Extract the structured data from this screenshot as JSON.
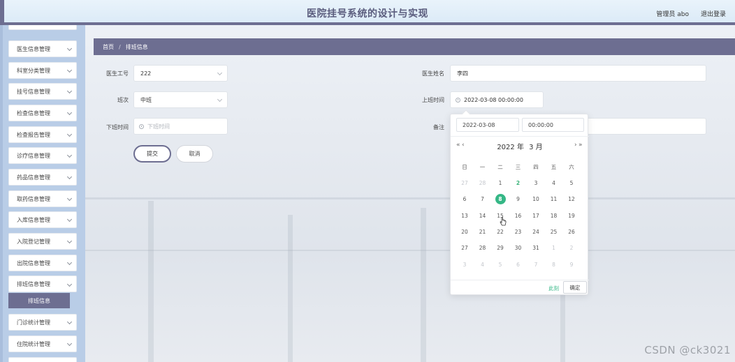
{
  "header": {
    "title": "医院挂号系统的设计与实现",
    "admin_label": "管理员 abo",
    "logout_label": "退出登录"
  },
  "sidebar": {
    "items": [
      {
        "label": "医生信息管理",
        "top": 0
      },
      {
        "label": "科室分类管理"
      },
      {
        "label": "挂号信息管理"
      },
      {
        "label": "检查信息管理"
      },
      {
        "label": "检查报告管理"
      },
      {
        "label": "诊疗信息管理"
      },
      {
        "label": "药品信息管理"
      },
      {
        "label": "取药信息管理"
      },
      {
        "label": "入库信息管理"
      },
      {
        "label": "入院登记管理"
      },
      {
        "label": "出院信息管理"
      },
      {
        "label": "排班信息管理"
      },
      {
        "label": "门诊统计管理"
      },
      {
        "label": "住院统计管理"
      }
    ],
    "active_sub": "排班信息"
  },
  "breadcrumb": {
    "home": "首页",
    "separator": "/",
    "current": "排班信息"
  },
  "form": {
    "doctor_id": {
      "label": "医生工号",
      "value": "222"
    },
    "doctor_name": {
      "label": "医生姓名",
      "value": "李四"
    },
    "shift": {
      "label": "班次",
      "value": "中班"
    },
    "start_time": {
      "label": "上班时间",
      "value": "2022-03-08 00:00:00"
    },
    "end_time": {
      "label": "下班时间",
      "placeholder": "下班时间"
    },
    "remark": {
      "label": "备注",
      "value": ""
    },
    "submit_label": "提交",
    "cancel_label": "取消"
  },
  "date_picker": {
    "date_input": "2022-03-08",
    "time_input": "00:00:00",
    "prev_year": "«",
    "prev_month": "‹",
    "next_month": "›",
    "next_year": "»",
    "year": "2022 年",
    "month": "3 月",
    "weekdays": [
      "日",
      "一",
      "二",
      "三",
      "四",
      "五",
      "六"
    ],
    "weeks": [
      [
        {
          "d": "27",
          "m": true
        },
        {
          "d": "28",
          "m": true
        },
        {
          "d": "1"
        },
        {
          "d": "2",
          "today": true
        },
        {
          "d": "3"
        },
        {
          "d": "4"
        },
        {
          "d": "5"
        }
      ],
      [
        {
          "d": "6"
        },
        {
          "d": "7"
        },
        {
          "d": "8",
          "sel": true
        },
        {
          "d": "9"
        },
        {
          "d": "10"
        },
        {
          "d": "11"
        },
        {
          "d": "12"
        }
      ],
      [
        {
          "d": "13"
        },
        {
          "d": "14"
        },
        {
          "d": "15"
        },
        {
          "d": "16"
        },
        {
          "d": "17"
        },
        {
          "d": "18"
        },
        {
          "d": "19"
        }
      ],
      [
        {
          "d": "20"
        },
        {
          "d": "21"
        },
        {
          "d": "22"
        },
        {
          "d": "23"
        },
        {
          "d": "24"
        },
        {
          "d": "25"
        },
        {
          "d": "26"
        }
      ],
      [
        {
          "d": "27"
        },
        {
          "d": "28"
        },
        {
          "d": "29"
        },
        {
          "d": "30"
        },
        {
          "d": "31"
        },
        {
          "d": "1",
          "m": true
        },
        {
          "d": "2",
          "m": true
        }
      ],
      [
        {
          "d": "3",
          "m": true
        },
        {
          "d": "4",
          "m": true
        },
        {
          "d": "5",
          "m": true
        },
        {
          "d": "6",
          "m": true
        },
        {
          "d": "7",
          "m": true
        },
        {
          "d": "8",
          "m": true
        },
        {
          "d": "9",
          "m": true
        }
      ]
    ],
    "now_label": "此刻",
    "confirm_label": "确定"
  },
  "watermark": "CSDN @ck3021",
  "colors": {
    "accent": "#6d6e91",
    "sidebar_bg": "#b9cde7",
    "selected_day": "#35b786"
  }
}
